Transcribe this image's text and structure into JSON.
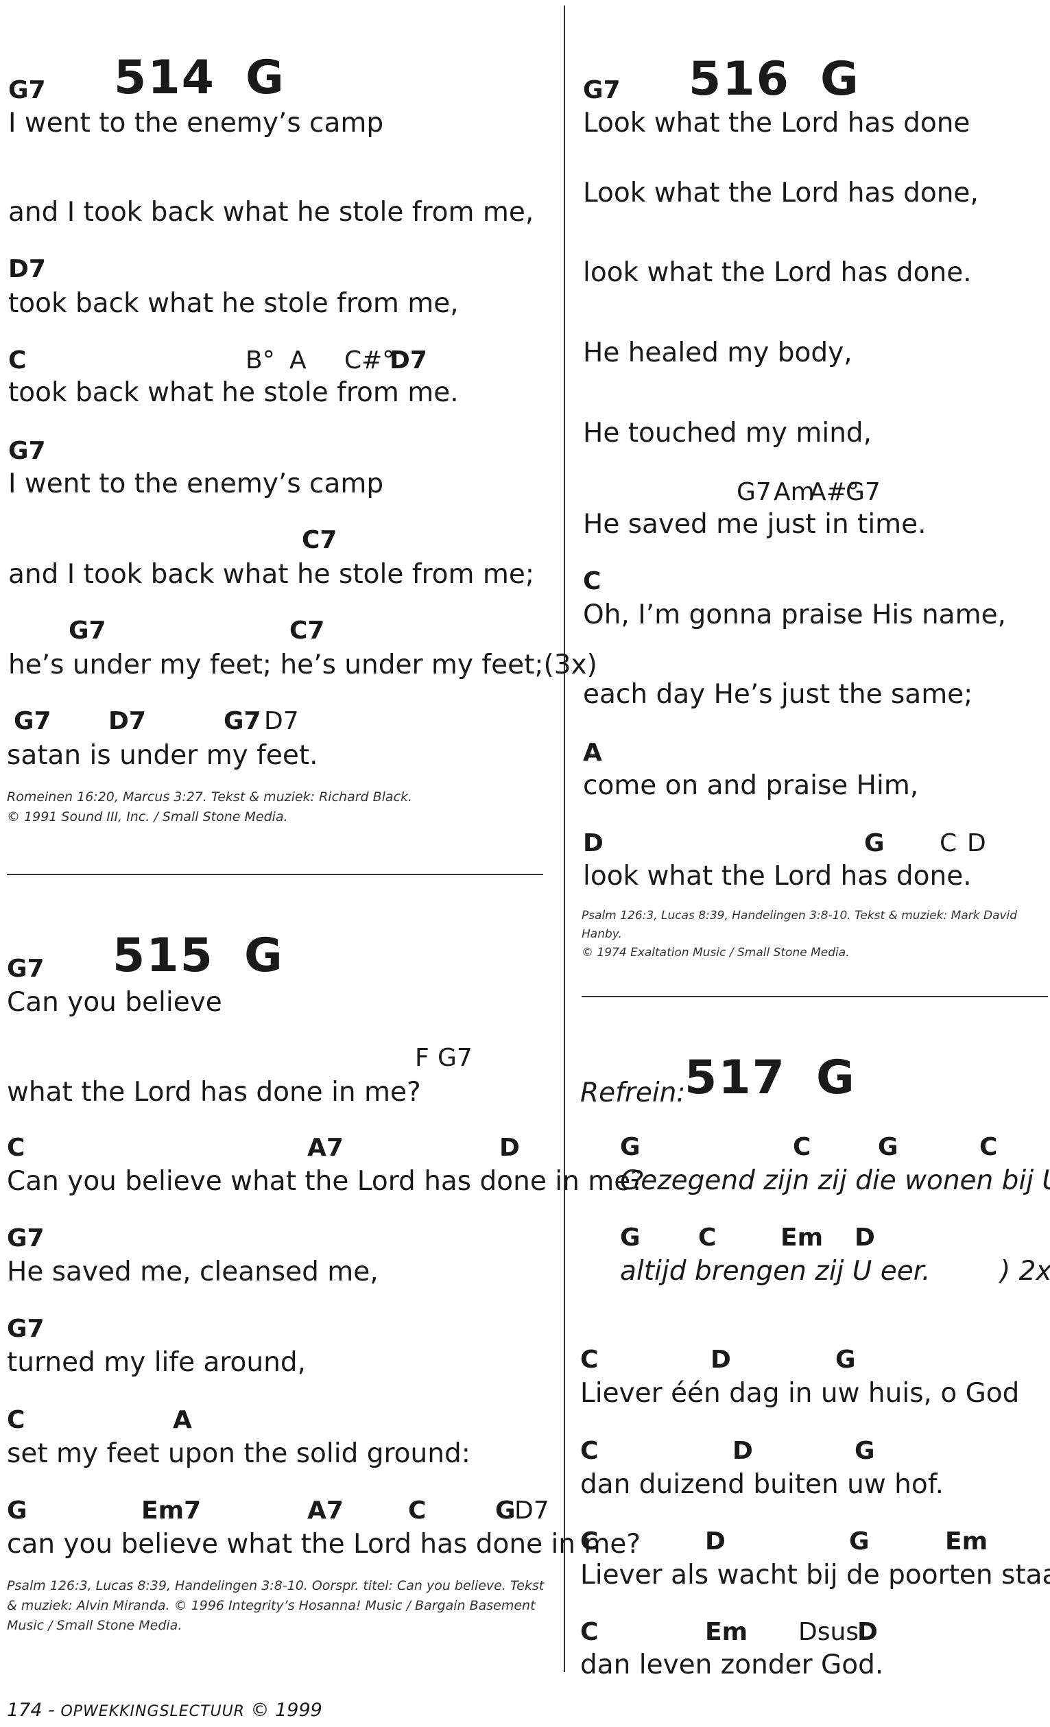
{
  "songs": {
    "s514": {
      "number": "514",
      "key": "G",
      "lines": [
        {
          "chords": [
            "G7"
          ],
          "lyric": "I went to the enemy’s camp"
        },
        {
          "lyric": "and I took back what he stole from me,"
        },
        {
          "chords": [
            "D7"
          ],
          "lyric": "took back what he stole from me,"
        },
        {
          "chords": [
            "C",
            "B°",
            "A",
            "C#°",
            "D7"
          ],
          "lyric": "took back what he stole from me."
        },
        {
          "chords": [
            "G7"
          ],
          "lyric": "I went to the enemy’s camp"
        },
        {
          "chords": [
            "C7"
          ],
          "lyric": "and I took back what he stole from me;"
        },
        {
          "chords": [
            "G7",
            "C7"
          ],
          "lyric": "he’s under my feet; he’s under my feet;(3x)"
        },
        {
          "chords": [
            "G7",
            "D7",
            "G7",
            "D7"
          ],
          "lyric": "satan is under my feet."
        }
      ],
      "credit": {
        "line1": "Romeinen 16:20, Marcus 3:27. Tekst & muziek: Richard Black.",
        "line2": "© 1991 Sound III, Inc. / Small Stone Media."
      }
    },
    "s515": {
      "number": "515",
      "key": "G",
      "lines": [
        {
          "chords": [
            "G7"
          ],
          "lyric": "Can you believe"
        },
        {
          "chords": [
            "F",
            "G7"
          ],
          "lyric": "what the Lord has done in me?"
        },
        {
          "chords": [
            "C",
            "A7",
            "D"
          ],
          "lyric": "Can you believe what the Lord has done in me?"
        },
        {
          "chords": [
            "G7"
          ],
          "lyric": "He saved me, cleansed me,"
        },
        {
          "chords": [
            "G7"
          ],
          "lyric": "turned my life around,"
        },
        {
          "chords": [
            "C",
            "A"
          ],
          "lyric": "set my feet upon the solid ground:"
        },
        {
          "chords": [
            "G",
            "Em7",
            "A7",
            "C",
            "G",
            "D7"
          ],
          "lyric": "can you believe what the Lord has done in me?"
        }
      ],
      "credit": "Psalm 126:3, Lucas 8:39, Handelingen 3:8-10. Oorspr. titel: Can you believe. Tekst & muziek: Alvin Miranda. © 1996 Integrity’s Hosanna! Music / Bargain Basement Music / Small Stone Media."
    },
    "s516": {
      "number": "516",
      "key": "G",
      "lines": [
        {
          "chords": [
            "G7"
          ],
          "lyric": "Look what the Lord has done"
        },
        {
          "lyric": "Look what the Lord has done,"
        },
        {
          "lyric": "look what the Lord has done."
        },
        {
          "lyric": "He healed my body,"
        },
        {
          "lyric": "He touched my mind,"
        },
        {
          "chords": [
            "G7",
            "Am",
            "A#°",
            "G7"
          ],
          "lyric": "He saved me just in time."
        },
        {
          "chords": [
            "C"
          ],
          "lyric": "Oh, I’m gonna praise His name,"
        },
        {
          "lyric": "each day He’s just the same;"
        },
        {
          "chords": [
            "A"
          ],
          "lyric": "come on and praise Him,"
        },
        {
          "chords": [
            "D",
            "G",
            "C",
            "D"
          ],
          "lyric": "look what the Lord has done."
        }
      ],
      "credit": {
        "line1": "Psalm 126:3, Lucas 8:39, Handelingen 3:8-10. Tekst & muziek: Mark David Hanby.",
        "line2": "© 1974 Exaltation Music / Small Stone Media."
      }
    },
    "s517": {
      "number": "517",
      "key": "G",
      "refrain_label": "Refrein:",
      "lines": [
        {
          "chords": [
            "G",
            "C",
            "G",
            "C"
          ],
          "lyric": "Gezegend zijn zij die wonen bij U; )"
        },
        {
          "chords": [
            "G",
            "C",
            "Em",
            "D"
          ],
          "lyric": "altijd brengen zij U eer.",
          "repeat": ") 2x"
        },
        {
          "chords": [
            "C",
            "D",
            "G"
          ],
          "lyric": "Liever één dag in uw huis, o God"
        },
        {
          "chords": [
            "C",
            "D",
            "G"
          ],
          "lyric": "dan duizend buiten uw hof."
        },
        {
          "chords": [
            "C",
            "D",
            "G",
            "Em"
          ],
          "lyric": "Liever als wacht bij de poorten staan"
        },
        {
          "chords": [
            "C",
            "Em",
            "Dsus",
            "D"
          ],
          "lyric": "dan leven zonder God."
        }
      ]
    }
  },
  "footer": {
    "page_number": "174",
    "separator": " - ",
    "publication": "OPWEKKINGSLECTUUR",
    "copyright": " © 1999"
  }
}
